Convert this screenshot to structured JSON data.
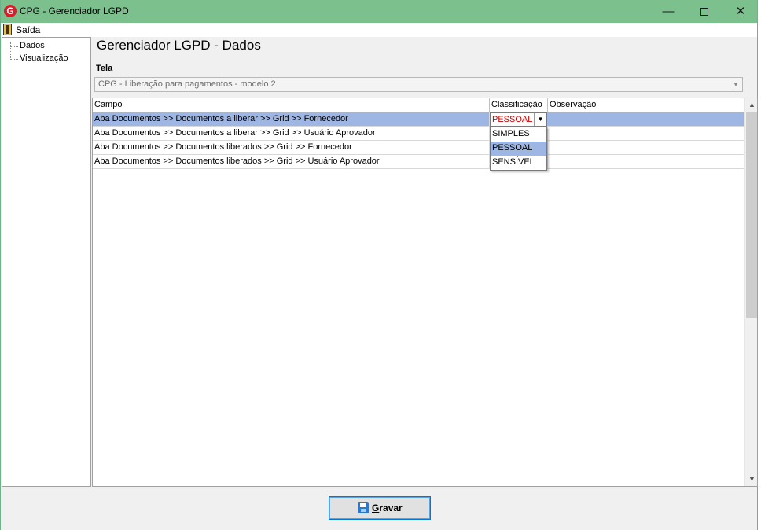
{
  "window": {
    "title": "CPG - Gerenciador LGPD",
    "logo_letter": "G",
    "minimize_glyph": "—",
    "close_glyph": "✕"
  },
  "menu": {
    "exit_label": "Saída"
  },
  "tree": {
    "items": [
      {
        "label": "Dados"
      },
      {
        "label": "Visualização"
      }
    ]
  },
  "main": {
    "title": "Gerenciador LGPD - Dados",
    "tela_label": "Tela",
    "tela_value": "CPG - Liberação para pagamentos - modelo 2"
  },
  "grid": {
    "columns": [
      "Campo",
      "Classificação",
      "Observação"
    ],
    "rows": [
      {
        "campo": "Aba Documentos >> Documentos a liberar >> Grid >> Fornecedor",
        "classificacao": "PESSOAL",
        "observacao": ""
      },
      {
        "campo": "Aba Documentos >> Documentos a liberar >> Grid >> Usuário Aprovador",
        "classificacao": "",
        "observacao": ""
      },
      {
        "campo": "Aba Documentos >> Documentos liberados >> Grid >> Fornecedor",
        "classificacao": "",
        "observacao": ""
      },
      {
        "campo": "Aba Documentos >> Documentos liberados >> Grid >> Usuário Aprovador",
        "classificacao": "",
        "observacao": ""
      }
    ],
    "selected_row": 0,
    "editor_value": "PESSOAL",
    "dropdown_options": [
      "SIMPLES",
      "PESSOAL",
      "SENSÍVEL"
    ],
    "highlighted_option": "PESSOAL"
  },
  "footer": {
    "save_label": "Gravar"
  },
  "colors": {
    "titlebar": "#7cc08e",
    "selection": "#9eb6e4",
    "editor_text": "#cc0000",
    "button_border": "#0078d7"
  }
}
